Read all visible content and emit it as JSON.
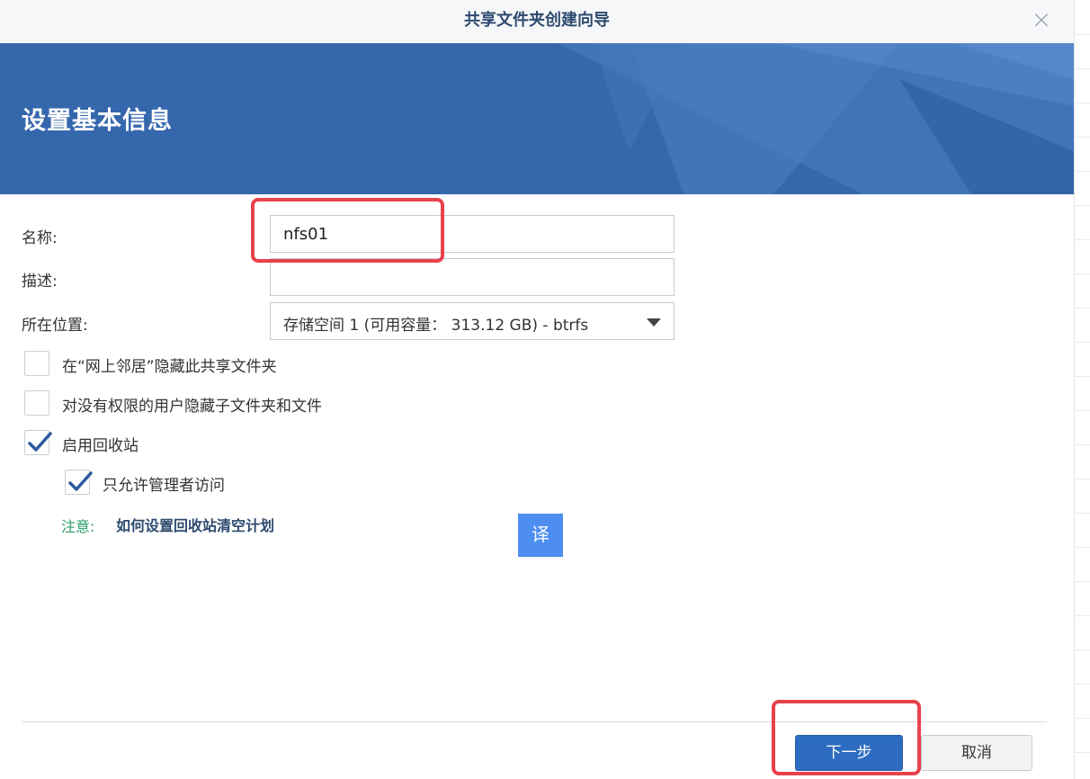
{
  "dialog": {
    "title": "共享文件夹创建向导",
    "close_symbol": "×"
  },
  "banner": {
    "title": "设置基本信息"
  },
  "form": {
    "name_label": "名称:",
    "name_value": "nfs01",
    "description_label": "描述:",
    "description_value": "",
    "location_label": "所在位置:",
    "location_value": "存储空间 1 (可用容量： 313.12 GB) - btrfs"
  },
  "options": {
    "hide_network": {
      "label": "在“网上邻居”隐藏此共享文件夹",
      "checked": false
    },
    "hide_unauthorized": {
      "label": "对没有权限的用户隐藏子文件夹和文件",
      "checked": false
    },
    "recycle_bin": {
      "label": "启用回收站",
      "checked": true
    },
    "admin_only": {
      "label": "只允许管理者访问",
      "checked": true
    }
  },
  "note": {
    "label": "注意:",
    "link": "如何设置回收站清空计划"
  },
  "translate_button": "译",
  "footer": {
    "next_label": "下一步",
    "cancel_label": "取消"
  },
  "colors": {
    "banner": "#3567ad",
    "primary_button": "#2d6cc0",
    "highlight": "#e8424a",
    "note_label": "#2a9d6a",
    "translate": "#4d8ef0"
  },
  "icons": {
    "close": "close-icon",
    "dropdown": "chevron-down-icon",
    "checkmark": "checkmark-icon"
  }
}
